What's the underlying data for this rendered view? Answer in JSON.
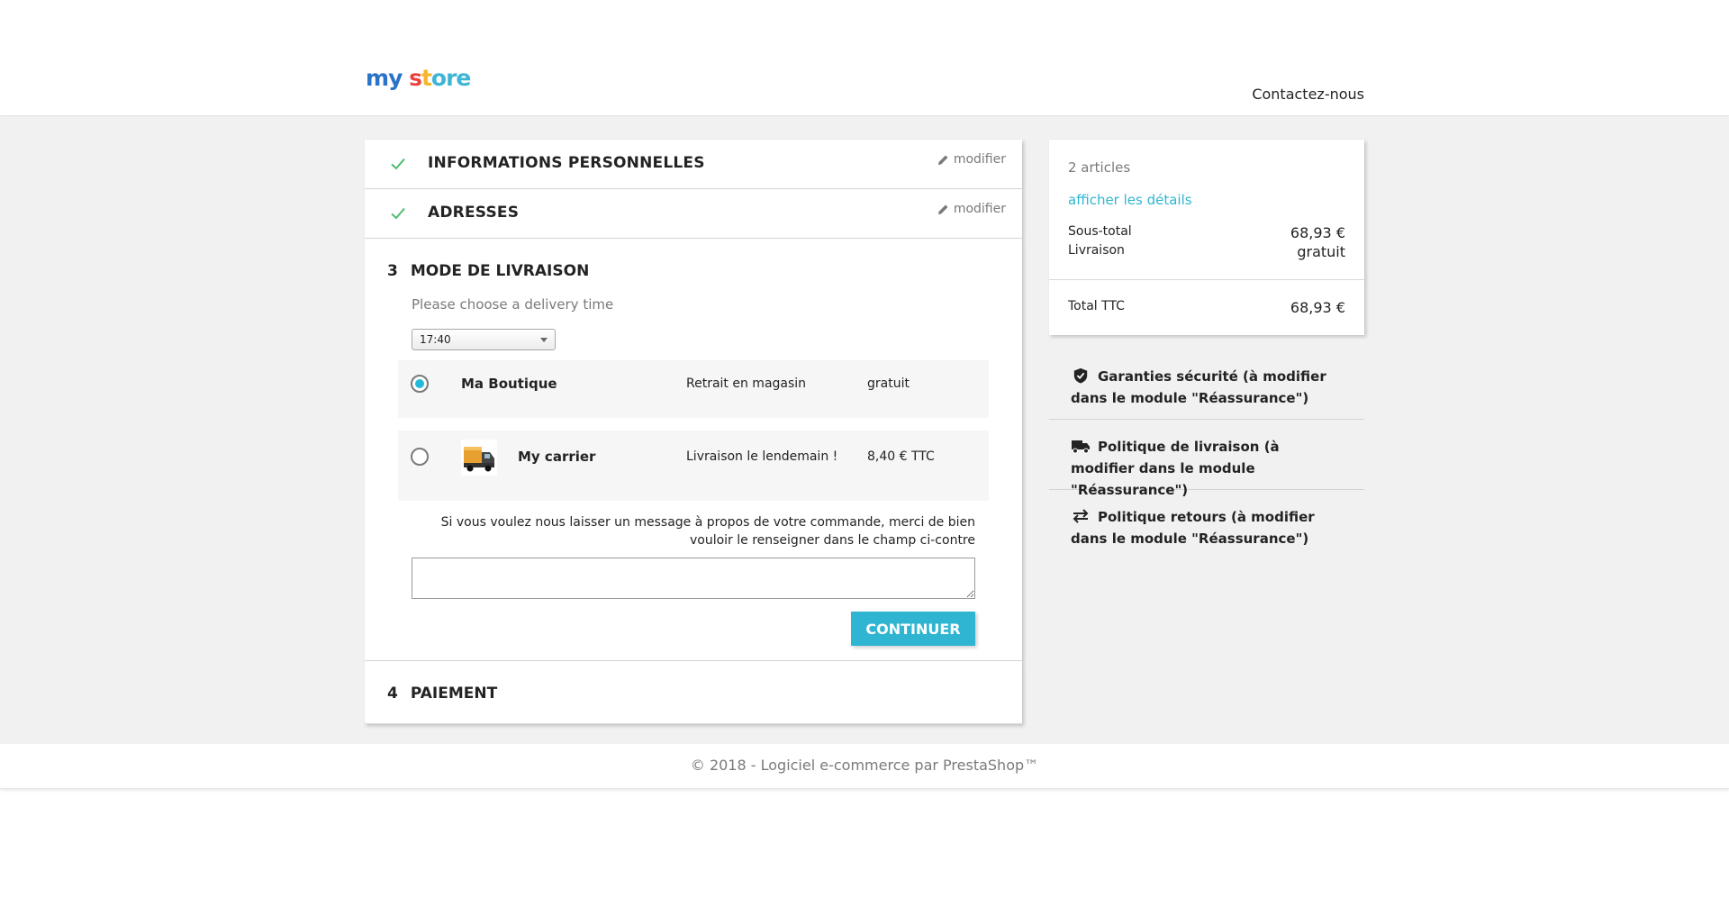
{
  "header": {
    "logo_parts": [
      "m",
      "y ",
      "s",
      "t",
      "ore"
    ],
    "contact_label": "Contactez-nous"
  },
  "checkout": {
    "steps_done": [
      {
        "title": "Informations personnelles",
        "edit_label": "modifier"
      },
      {
        "title": "Adresses",
        "edit_label": "modifier"
      }
    ],
    "current_step": {
      "number": "3",
      "title": "Mode de livraison",
      "delivery_time_label": "Please choose a delivery time",
      "delivery_time_value": "17:40",
      "carriers": [
        {
          "name": "Ma Boutique",
          "delay": "Retrait en magasin",
          "price": "gratuit",
          "selected": true
        },
        {
          "name": "My carrier",
          "delay": "Livraison le lendemain !",
          "price": "8,40 € TTC",
          "selected": false
        }
      ],
      "message_label": "Si vous voulez nous laisser un message à propos de votre commande, merci de bien vouloir le renseigner dans le champ ci-contre",
      "message_value": "",
      "continue_label": "Continuer"
    },
    "payment_step": {
      "number": "4",
      "title": "Paiement"
    }
  },
  "summary": {
    "items_count": "2 articles",
    "details_link": "afficher les détails",
    "subtotal_label": "Sous-total",
    "subtotal_value": "68,93 €",
    "shipping_label": "Livraison",
    "shipping_value": "gratuit",
    "total_label": "Total TTC",
    "total_value": "68,93 €"
  },
  "reassurance": [
    {
      "icon": "shield-check-icon",
      "text": "Garanties sécurité (à modifier dans le module \"Réassurance\")"
    },
    {
      "icon": "truck-icon",
      "text": "Politique de livraison (à modifier dans le module \"Réassurance\")"
    },
    {
      "icon": "swap-arrows-icon",
      "text": "Politique retours (à modifier dans le module \"Réassurance\")"
    }
  ],
  "footer": {
    "text": "© 2018 - Logiciel e-commerce par PrestaShop™"
  },
  "colors": {
    "accent": "#2fb5d2",
    "check_green": "#4cbb6c",
    "background": "#f1f1f1"
  }
}
